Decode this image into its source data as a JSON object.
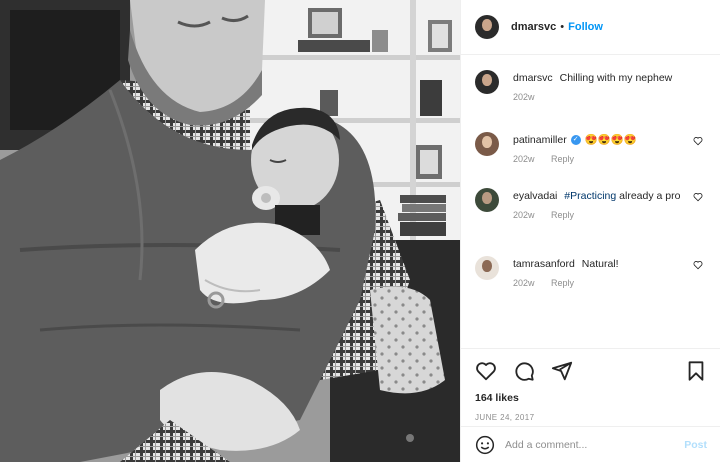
{
  "post": {
    "author": {
      "username": "dmarsvc",
      "follow_separator": "•",
      "follow_label": "Follow"
    },
    "caption": {
      "username": "dmarsvc",
      "text": "Chilling with my nephew",
      "age": "202w"
    },
    "comments": [
      {
        "username": "patinamiller",
        "verified": true,
        "text": "😍😍😍😍",
        "age": "202w",
        "reply_label": "Reply"
      },
      {
        "username": "eyalvadai",
        "verified": false,
        "hashtag": "#Practicing",
        "text": "already a pro",
        "age": "202w",
        "reply_label": "Reply"
      },
      {
        "username": "tamrasanford",
        "verified": false,
        "text": "Natural!",
        "age": "202w",
        "reply_label": "Reply"
      }
    ],
    "likes": "164 likes",
    "date": "JUNE 24, 2017",
    "add_comment": {
      "placeholder": "Add a comment...",
      "post_label": "Post"
    },
    "icons": {
      "like": "heart-icon",
      "comment": "comment-icon",
      "share": "share-icon",
      "save": "bookmark-icon",
      "emoji": "emoji-icon"
    },
    "colors": {
      "link_blue": "#0095f6",
      "muted": "#8e8e8e",
      "post_disabled": "#b2dffc",
      "text": "#262626"
    }
  }
}
